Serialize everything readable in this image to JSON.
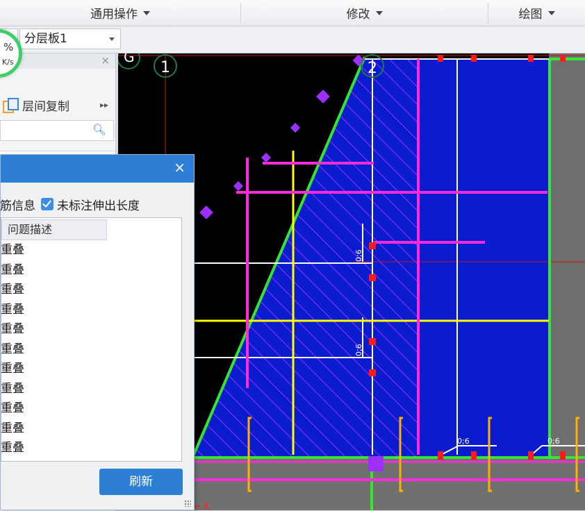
{
  "toolbar": {
    "menus": [
      {
        "label": "通用操作"
      },
      {
        "label": "修改"
      },
      {
        "label": "绘图"
      }
    ]
  },
  "floor_select": {
    "value": "分层板1"
  },
  "speed_widget": {
    "percent": "%",
    "rate": "K/s"
  },
  "left_panel": {
    "close": "×",
    "copy_button": "层间复制",
    "copy_more": "▸▸",
    "search_icon": "search-icon"
  },
  "canvas": {
    "axis_labels": [
      "G",
      "1",
      "2"
    ],
    "dimension_labels": [
      "0;6",
      "0;6",
      "0;6",
      "0;6"
    ],
    "axis_x_label": "X",
    "colors": {
      "slab": "#0b1bd0",
      "rebar_magenta": "#ff2ad9",
      "rebar_yellow": "#ffff00",
      "edge_green": "#33e633",
      "gray": "#6c6c6c"
    }
  },
  "dialog": {
    "close": "×",
    "check1_label": "箍筋信息",
    "check2_label": "未标注伸出长度",
    "column_header": "问题描述",
    "rows": [
      "围重叠",
      "围重叠",
      "围重叠",
      "围重叠",
      "围重叠",
      "围重叠",
      "围重叠",
      "围重叠",
      "围重叠",
      "围重叠",
      "围重叠"
    ],
    "refresh_button": "刷新"
  }
}
